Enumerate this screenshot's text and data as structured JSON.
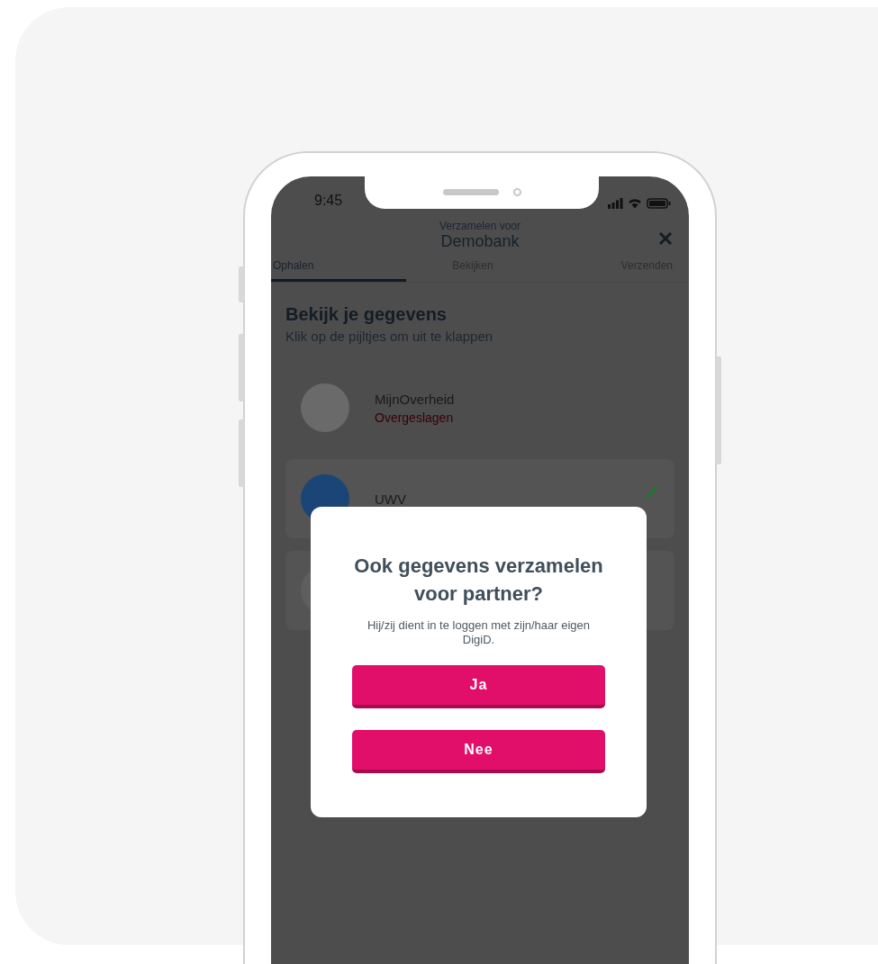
{
  "status_bar": {
    "time": "9:45"
  },
  "header": {
    "subtitle": "Verzamelen voor",
    "title": "Demobank"
  },
  "tabs": [
    {
      "label": "Ophalen",
      "selected": true
    },
    {
      "label": "Bekijken",
      "selected": false
    },
    {
      "label": "Verzenden",
      "selected": false
    }
  ],
  "page": {
    "title": "Bekijk je gegevens",
    "subtitle": "Klik op de pijltjes om uit te klappen"
  },
  "sources": [
    {
      "kind": "skipped",
      "name": "MijnOverheid",
      "status": "Overgeslagen"
    },
    {
      "kind": "done",
      "name": "UWV"
    },
    {
      "kind": "covered"
    }
  ],
  "dialog": {
    "title": "Ook gegevens verzamelen voor partner?",
    "message": "Hij/zij dient in te loggen met zijn/haar eigen DigiD.",
    "buttons": [
      "Ja",
      "Nee"
    ]
  }
}
